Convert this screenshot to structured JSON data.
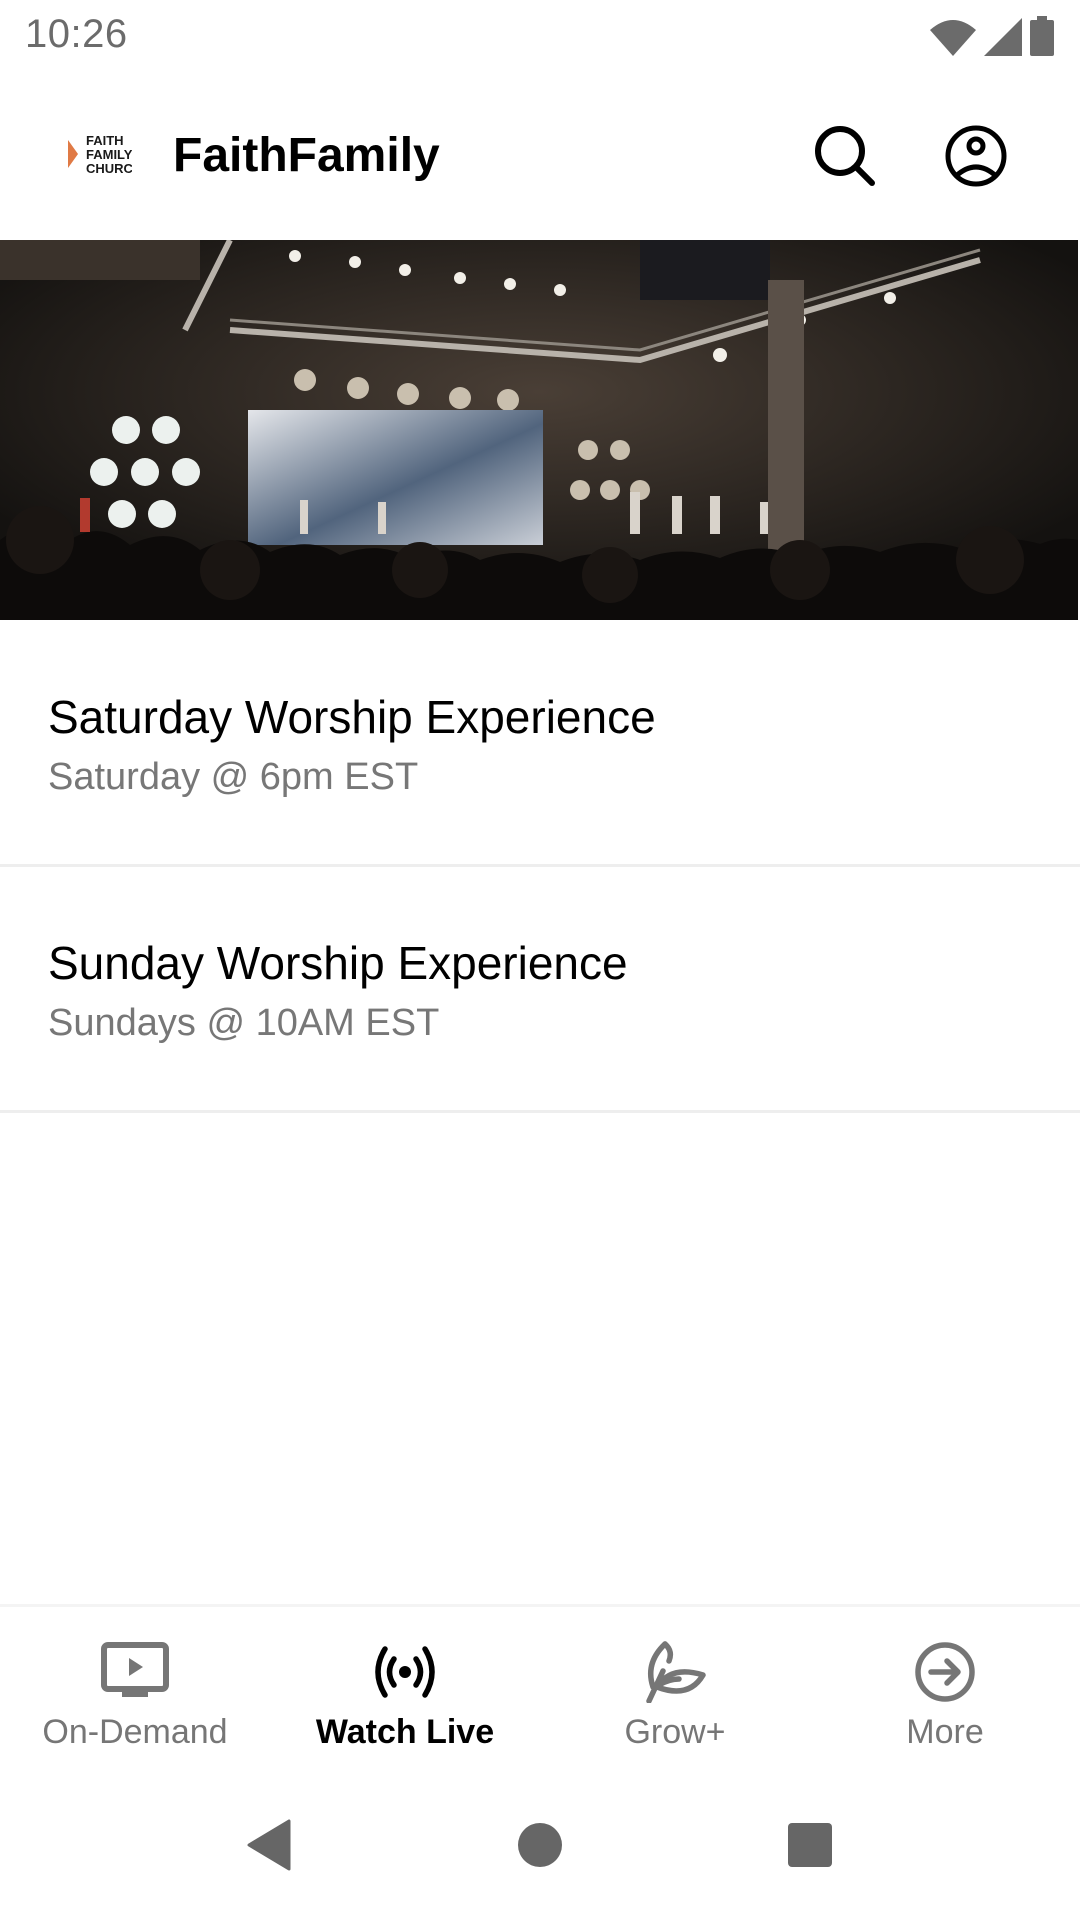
{
  "status_bar": {
    "time": "10:26",
    "icons": [
      "wifi-icon",
      "cellular-signal-icon",
      "battery-icon"
    ]
  },
  "header": {
    "logo_lines": [
      "FAITH",
      "FAMILY",
      "CHURCH"
    ],
    "title": "FaithFamily",
    "actions": [
      {
        "name": "search-button",
        "icon": "search-icon"
      },
      {
        "name": "profile-button",
        "icon": "account-circle-icon"
      }
    ]
  },
  "banner": {
    "alt": "Worship concert stage with band and crowd"
  },
  "streams": [
    {
      "title": "Saturday Worship Experience",
      "schedule": "Saturday @ 6pm EST"
    },
    {
      "title": "Sunday Worship Experience",
      "schedule": "Sundays @ 10AM EST"
    }
  ],
  "bottom_nav": {
    "items": [
      {
        "label": "On-Demand",
        "icon": "tv-play-icon",
        "active": false
      },
      {
        "label": "Watch Live",
        "icon": "live-broadcast-icon",
        "active": true
      },
      {
        "label": "Grow+",
        "icon": "leaf-icon",
        "active": false
      },
      {
        "label": "More",
        "icon": "arrow-circle-right-icon",
        "active": false
      }
    ]
  },
  "colors": {
    "active": "#000000",
    "inactive": "#767676",
    "divider": "#eeeeee",
    "logo_accent": "#e07a45"
  }
}
